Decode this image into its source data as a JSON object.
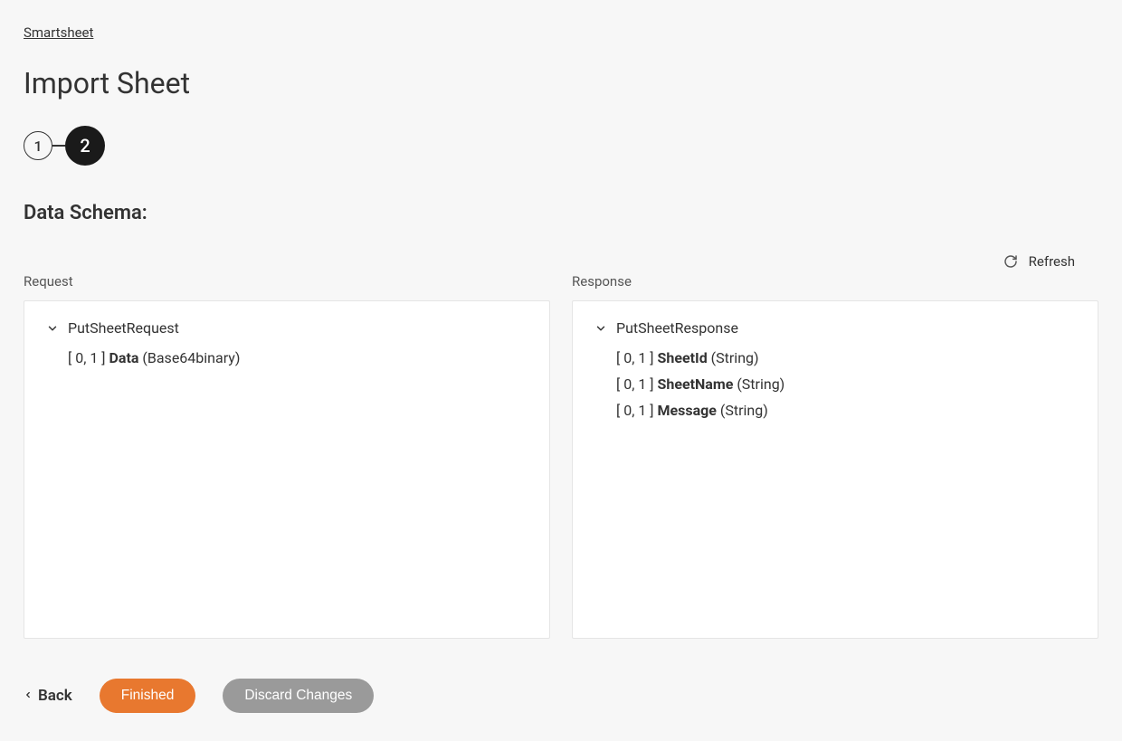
{
  "breadcrumb": {
    "label": "Smartsheet"
  },
  "page": {
    "title": "Import Sheet"
  },
  "stepper": {
    "step1": "1",
    "step2": "2"
  },
  "section": {
    "title": "Data Schema:"
  },
  "refresh": {
    "label": "Refresh"
  },
  "request": {
    "label": "Request",
    "root": "PutSheetRequest",
    "fields": [
      {
        "cardinality": "[ 0, 1 ] ",
        "name": "Data",
        "type": " (Base64binary)"
      }
    ]
  },
  "response": {
    "label": "Response",
    "root": "PutSheetResponse",
    "fields": [
      {
        "cardinality": "[ 0, 1 ] ",
        "name": "SheetId",
        "type": " (String)"
      },
      {
        "cardinality": "[ 0, 1 ] ",
        "name": "SheetName",
        "type": " (String)"
      },
      {
        "cardinality": "[ 0, 1 ] ",
        "name": "Message",
        "type": " (String)"
      }
    ]
  },
  "footer": {
    "back": "Back",
    "finished": "Finished",
    "discard": "Discard Changes"
  }
}
